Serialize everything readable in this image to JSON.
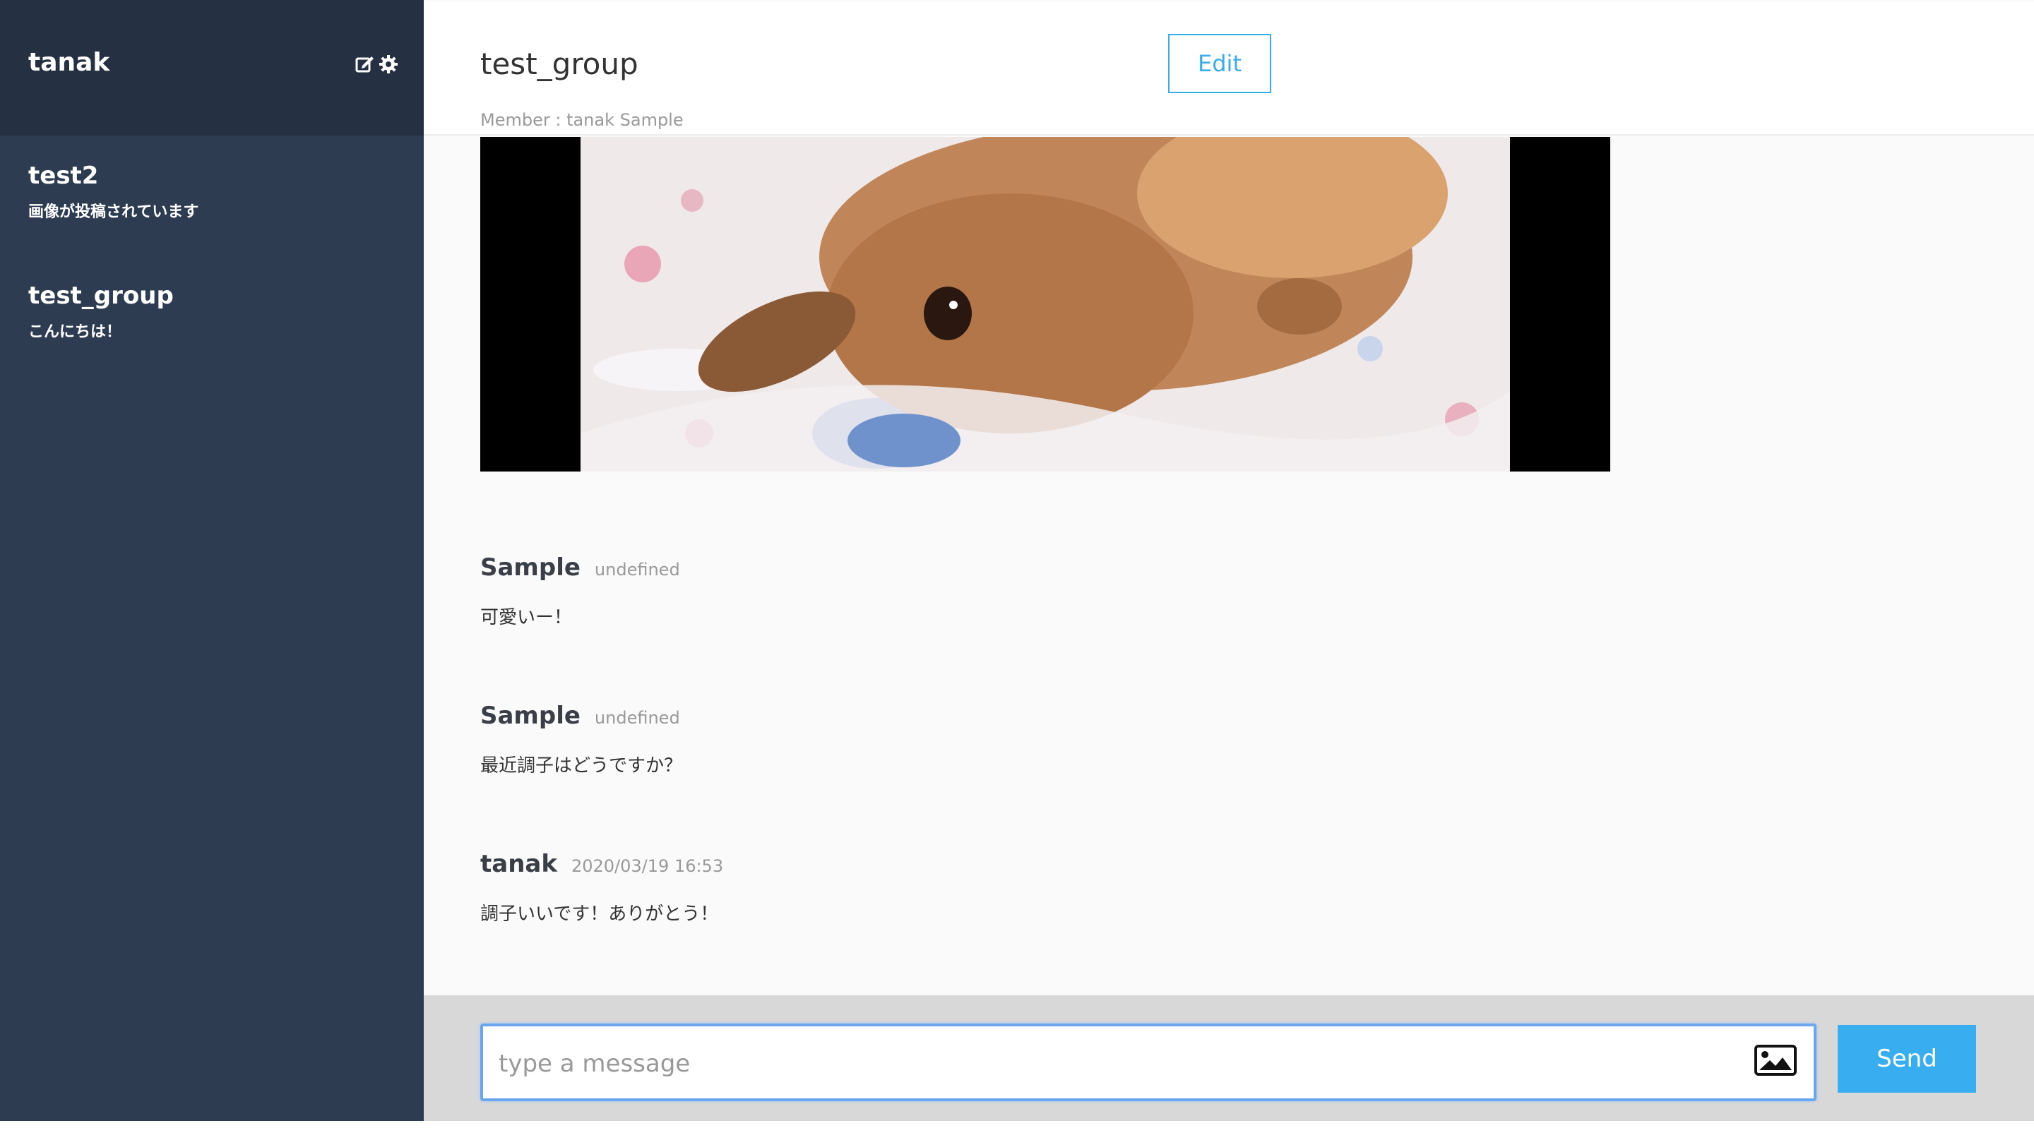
{
  "sidebar": {
    "user_name": "tanak",
    "icons": [
      "edit-icon",
      "gear-icon"
    ],
    "groups": [
      {
        "name": "test2",
        "last_message": "画像が投稿されています"
      },
      {
        "name": "test_group",
        "last_message": "こんにちは！"
      }
    ]
  },
  "header": {
    "group_name": "test_group",
    "members": "Member : tanak Sample",
    "edit_label": "Edit"
  },
  "messages": [
    {
      "user": "Sample",
      "date": "undefined",
      "text": "可愛いー！"
    },
    {
      "user": "Sample",
      "date": "undefined",
      "text": "最近調子はどうですか？"
    },
    {
      "user": "tanak",
      "date": "2020/03/19 16:53",
      "text": "調子いいです！ありがとう！"
    }
  ],
  "form": {
    "placeholder": "type a message",
    "send_label": "Send",
    "image_icon": "image-upload-icon"
  },
  "colors": {
    "sidebar_bg": "#2e3c52",
    "sidebar_header_bg": "#253142",
    "accent": "#38aef0",
    "input_focus": "#6aa5ee"
  }
}
